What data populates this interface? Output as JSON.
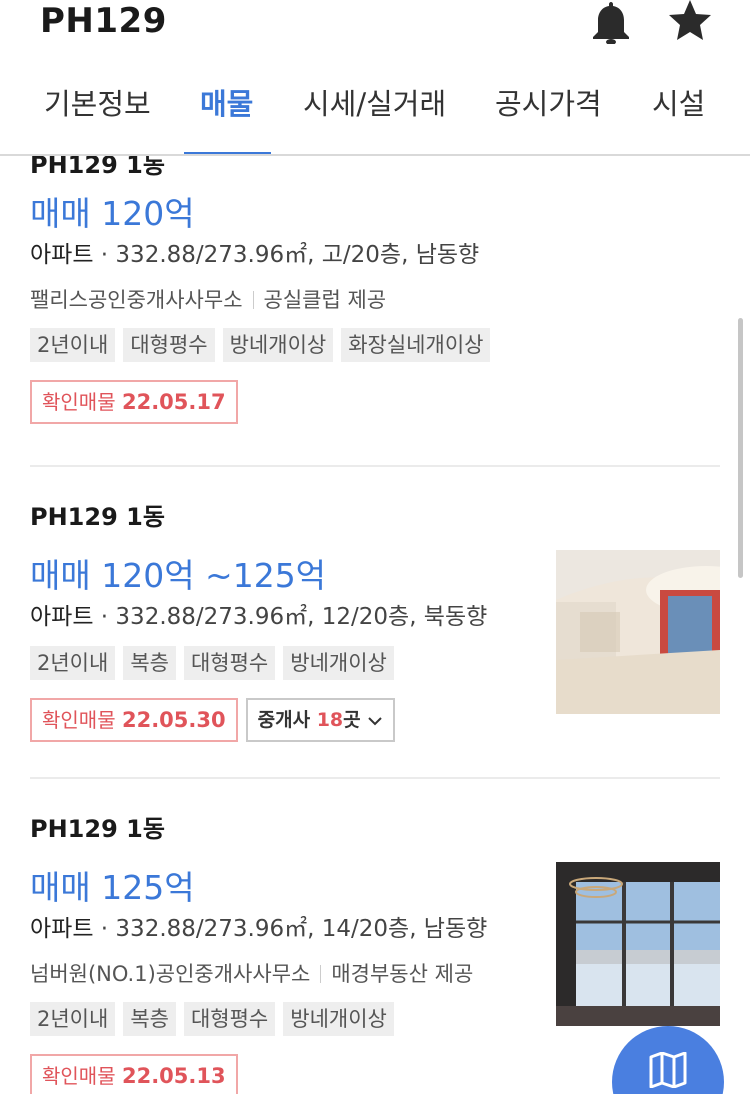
{
  "header": {
    "title": "PH129",
    "tabs": [
      {
        "label": "기본정보",
        "active": false
      },
      {
        "label": "매물",
        "active": true
      },
      {
        "label": "시세/실거래",
        "active": false
      },
      {
        "label": "공시가격",
        "active": false
      },
      {
        "label": "시설",
        "active": false
      }
    ]
  },
  "listings": [
    {
      "complex": "PH129 1동",
      "price": "매매 120억",
      "type": "아파트",
      "details": "332.88/273.96㎡, 고/20층, 남동향",
      "agent": "팰리스공인중개사사무소",
      "provider": "공실클럽 제공",
      "tags": [
        "2년이내",
        "대형평수",
        "방네개이상",
        "화장실네개이상"
      ],
      "verify_label": "확인매물",
      "verify_date": "22.05.17"
    },
    {
      "complex": "PH129 1동",
      "price": "매매 120억 ~125억",
      "type": "아파트",
      "details": "332.88/273.96㎡, 12/20층, 북동향",
      "tags": [
        "2년이내",
        "복층",
        "대형평수",
        "방네개이상"
      ],
      "verify_label": "확인매물",
      "verify_date": "22.05.30",
      "agency_label": "중개사",
      "agency_count": "18",
      "agency_unit": "곳",
      "thumbnail": "interior-hall-photo"
    },
    {
      "complex": "PH129 1동",
      "price": "매매 125억",
      "type": "아파트",
      "details": "332.88/273.96㎡, 14/20층, 남동향",
      "agent": "넘버원(NO.1)공인중개사사무소",
      "provider": "매경부동산 제공",
      "tags": [
        "2년이내",
        "복층",
        "대형평수",
        "방네개이상"
      ],
      "verify_label": "확인매물",
      "verify_date": "22.05.13",
      "thumbnail": "window-view-photo"
    }
  ],
  "colors": {
    "accent": "#3b78d8",
    "verify": "#e0545a",
    "fab": "#4a7fe0"
  },
  "icons": [
    "bell-icon",
    "star-icon",
    "chevron-down-icon",
    "map-icon"
  ]
}
